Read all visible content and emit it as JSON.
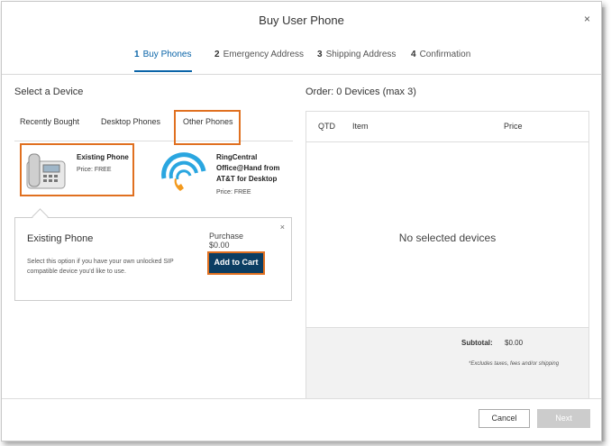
{
  "dialog": {
    "title": "Buy User Phone",
    "close": "×"
  },
  "steps": [
    {
      "num": "1",
      "label": "Buy Phones"
    },
    {
      "num": "2",
      "label": "Emergency Address"
    },
    {
      "num": "3",
      "label": "Shipping Address"
    },
    {
      "num": "4",
      "label": "Confirmation"
    }
  ],
  "left": {
    "heading": "Select a Device",
    "tabs": [
      "Recently Bought",
      "Desktop Phones",
      "Other Phones"
    ],
    "devices": [
      {
        "name": "Existing Phone",
        "price": "Price: FREE"
      },
      {
        "name_lines": [
          "RingCentral",
          "Office@Hand from",
          "AT&T for Desktop"
        ],
        "price": "Price: FREE"
      }
    ]
  },
  "popover": {
    "title": "Existing Phone",
    "description": "Select this option if you have your own unlocked SIP compatible device you'd like to use.",
    "purchase_label": "Purchase",
    "purchase_price": "$0.00",
    "add_button": "Add to Cart",
    "close": "×"
  },
  "order": {
    "heading": "Order: 0 Devices (max 3)",
    "columns": [
      "QTD",
      "Item",
      "Price"
    ],
    "empty_message": "No selected devices",
    "subtotal_label": "Subtotal:",
    "subtotal_value": "$0.00",
    "note": "*Excludes taxes, fees and/or shipping"
  },
  "footer": {
    "cancel": "Cancel",
    "next": "Next"
  },
  "colors": {
    "accent": "#0a64a8",
    "button_dark": "#0b3e63",
    "highlight": "#e07020"
  }
}
